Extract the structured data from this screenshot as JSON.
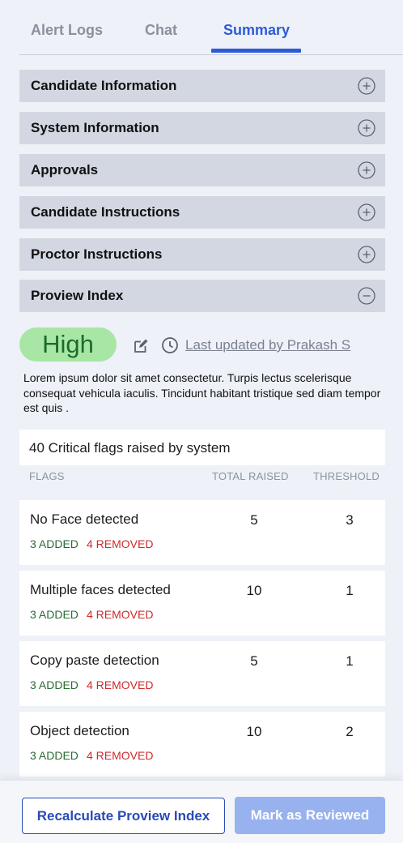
{
  "tabs": [
    {
      "label": "Alert Logs"
    },
    {
      "label": "Chat"
    },
    {
      "label": "Summary"
    }
  ],
  "active_tab": "Summary",
  "sections": [
    {
      "label": "Candidate Information",
      "state": "collapsed"
    },
    {
      "label": "System Information",
      "state": "collapsed"
    },
    {
      "label": "Approvals",
      "state": "collapsed"
    },
    {
      "label": "Candidate Instructions",
      "state": "collapsed"
    },
    {
      "label": "Proctor Instructions",
      "state": "collapsed"
    },
    {
      "label": "Proview Index",
      "state": "expanded"
    }
  ],
  "proview_index": {
    "level": "High",
    "last_updated": "Last updated by Prakash S",
    "description": "Lorem ipsum dolor sit amet consectetur. Turpis lectus scelerisque consequat vehicula iaculis. Tincidunt habitant tristique sed diam tempor est quis ."
  },
  "flags": {
    "summary": "40 Critical flags raised by system",
    "columns": {
      "flags": "FLAGS",
      "total": "TOTAL RAISED",
      "threshold": "THRESHOLD"
    },
    "rows": [
      {
        "name": "No Face detected",
        "added": "3 ADDED",
        "removed": "4 REMOVED",
        "total": "5",
        "threshold": "3"
      },
      {
        "name": "Multiple faces detected",
        "added": "3 ADDED",
        "removed": "4 REMOVED",
        "total": "10",
        "threshold": "1"
      },
      {
        "name": "Copy paste detection",
        "added": "3 ADDED",
        "removed": "4 REMOVED",
        "total": "5",
        "threshold": "1"
      },
      {
        "name": "Object detection",
        "added": "3 ADDED",
        "removed": "4 REMOVED",
        "total": "10",
        "threshold": "2"
      }
    ]
  },
  "footer": {
    "recalculate_label": "Recalculate Proview Index",
    "reviewed_label": "Mark as Reviewed"
  },
  "icons": {
    "expand": "plus-circle-icon",
    "collapse": "minus-circle-icon",
    "edit": "edit-icon",
    "history": "clock-icon"
  },
  "colors": {
    "accent": "#2d5bd8",
    "high_badge_bg": "#a7e6a4",
    "high_badge_text": "#1c6b2a",
    "added": "#2c6b34",
    "removed": "#cc2b2b",
    "disabled_button": "#98b2ef"
  }
}
